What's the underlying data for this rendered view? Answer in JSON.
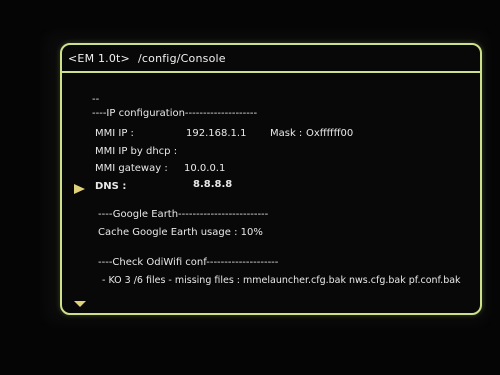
{
  "title_bar": {
    "app": "<EM 1.0t>",
    "path": "/config/Console"
  },
  "console": {
    "top_marker": "--",
    "ip_header": "----IP configuration--------------------",
    "mmi_ip_label": "MMI IP :",
    "mmi_ip_value": "192.168.1.1",
    "mask_label": "Mask :",
    "mask_value": "Oxffffff00",
    "dhcp_label": "MMI IP by dhcp :",
    "gateway_label": "MMI gateway :",
    "gateway_value": "10.0.0.1",
    "dns_label": "DNS :",
    "dns_value": "8.8.8.8",
    "ge_header": "----Google Earth-------------------------",
    "ge_cache": "Cache Google Earth usage :  10%",
    "odi_header": "----Check OdiWifi conf--------------------",
    "odi_result": "- KO  3 /6 files - missing files :  mmelauncher.cfg.bak  nws.cfg.bak  pf.conf.bak"
  },
  "icons": {
    "selection": "triangle-right-icon",
    "scroll": "triangle-down-icon"
  },
  "colors": {
    "frame": "#cde08a",
    "arrow": "#e0d27a",
    "text": "#e9e9e9",
    "background": "#070807"
  }
}
